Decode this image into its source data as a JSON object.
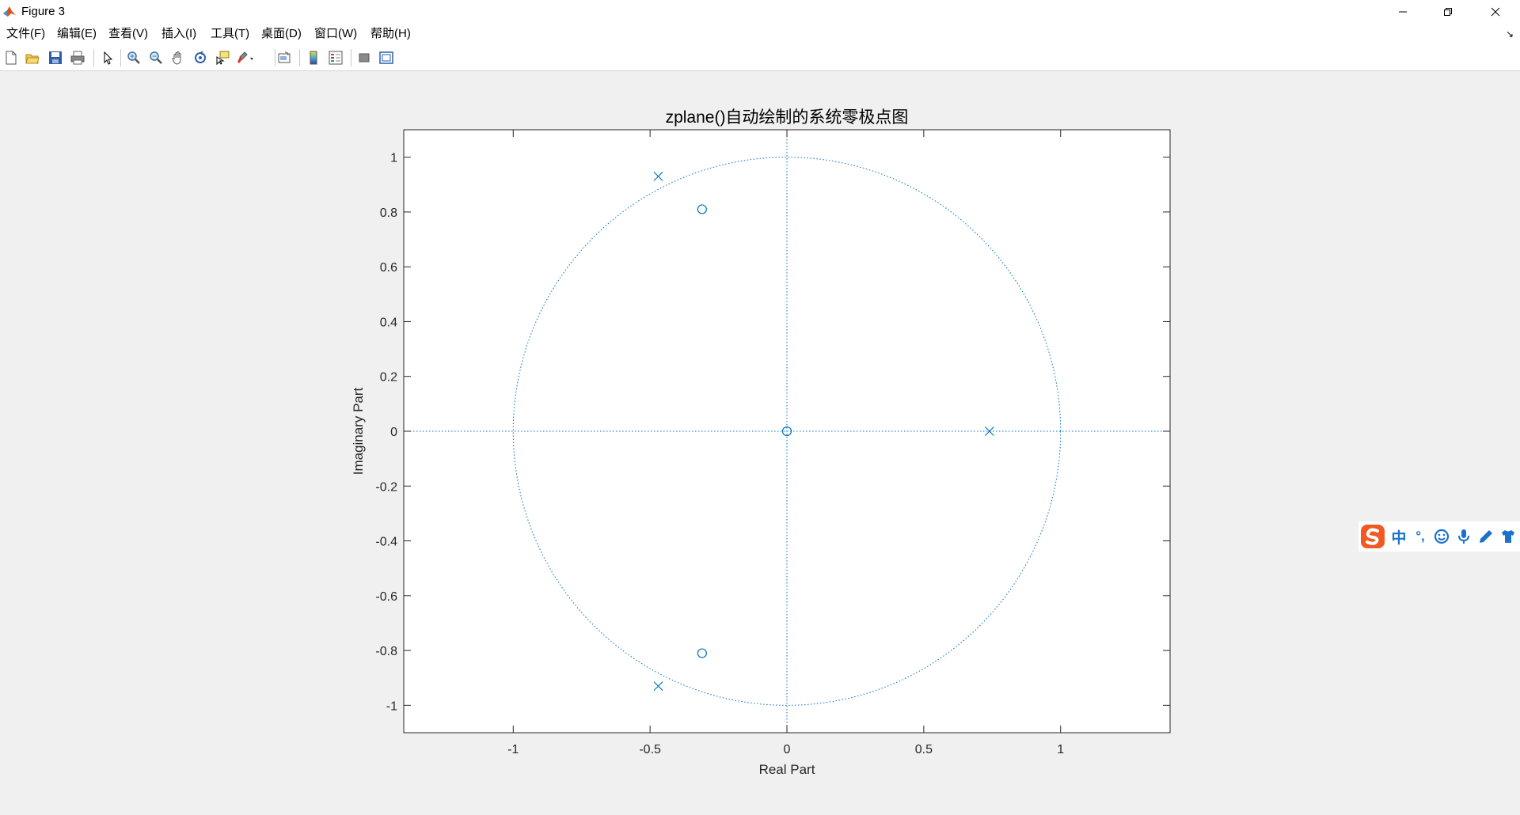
{
  "window": {
    "title": "Figure 3",
    "controls": {
      "minimize": "minimize",
      "restore": "restore",
      "close": "close"
    }
  },
  "menubar": {
    "items": [
      {
        "label": "文件(F)"
      },
      {
        "label": "编辑(E)"
      },
      {
        "label": "查看(V)"
      },
      {
        "label": "插入(I)"
      },
      {
        "label": "工具(T)"
      },
      {
        "label": "桌面(D)"
      },
      {
        "label": "窗口(W)"
      },
      {
        "label": "帮助(H)"
      }
    ]
  },
  "toolbar": {
    "buttons": [
      {
        "icon": "new-figure-icon"
      },
      {
        "icon": "open-file-icon"
      },
      {
        "icon": "save-icon"
      },
      {
        "icon": "print-icon"
      },
      {
        "icon": "edit-plot-arrow-icon"
      },
      {
        "icon": "zoom-in-icon"
      },
      {
        "icon": "zoom-out-icon"
      },
      {
        "icon": "pan-hand-icon"
      },
      {
        "icon": "rotate-3d-icon"
      },
      {
        "icon": "data-cursor-icon"
      },
      {
        "icon": "brush-icon"
      },
      {
        "icon": "link-plot-icon"
      },
      {
        "icon": "colorbar-icon"
      },
      {
        "icon": "legend-icon"
      },
      {
        "icon": "hide-plot-tools-icon"
      },
      {
        "icon": "show-plot-tools-icon"
      }
    ]
  },
  "colors": {
    "plot_blue": "#0072bd",
    "figure_bg": "#f0f0f0",
    "axes_bg": "#ffffff",
    "ime_blue": "#1a73c9",
    "ime_orange": "#f05a22"
  },
  "chart_data": {
    "type": "scatter",
    "title": "zplane()自动绘制的系统零极点图",
    "xlabel": "Real Part",
    "ylabel": "Imaginary Part",
    "xlim": [
      -1.4,
      1.4
    ],
    "ylim": [
      -1.1,
      1.1
    ],
    "xticks": [
      "-1",
      "-0.5",
      "0",
      "0.5",
      "1"
    ],
    "xtick_values": [
      -1,
      -0.5,
      0,
      0.5,
      1
    ],
    "yticks": [
      "1",
      "0.8",
      "0.6",
      "0.4",
      "0.2",
      "0",
      "-0.2",
      "-0.4",
      "-0.6",
      "-0.8",
      "-1"
    ],
    "ytick_values": [
      1,
      0.8,
      0.6,
      0.4,
      0.2,
      0,
      -0.2,
      -0.4,
      -0.6,
      -0.8,
      -1
    ],
    "unit_circle": true,
    "axis_lines": true,
    "grid": false,
    "series": [
      {
        "name": "zeros",
        "marker": "o",
        "points": [
          [
            0,
            0
          ],
          [
            -0.31,
            0.81
          ],
          [
            -0.31,
            -0.81
          ]
        ]
      },
      {
        "name": "poles",
        "marker": "x",
        "points": [
          [
            -0.47,
            0.93
          ],
          [
            -0.47,
            -0.93
          ],
          [
            0.74,
            0
          ]
        ]
      }
    ]
  },
  "ime": {
    "items": [
      {
        "icon": "sogou-logo-icon"
      },
      {
        "label": "中"
      },
      {
        "label": "°,"
      },
      {
        "icon": "emoji-icon"
      },
      {
        "icon": "microphone-icon"
      },
      {
        "icon": "pen-icon"
      },
      {
        "icon": "skin-shirt-icon"
      }
    ]
  }
}
